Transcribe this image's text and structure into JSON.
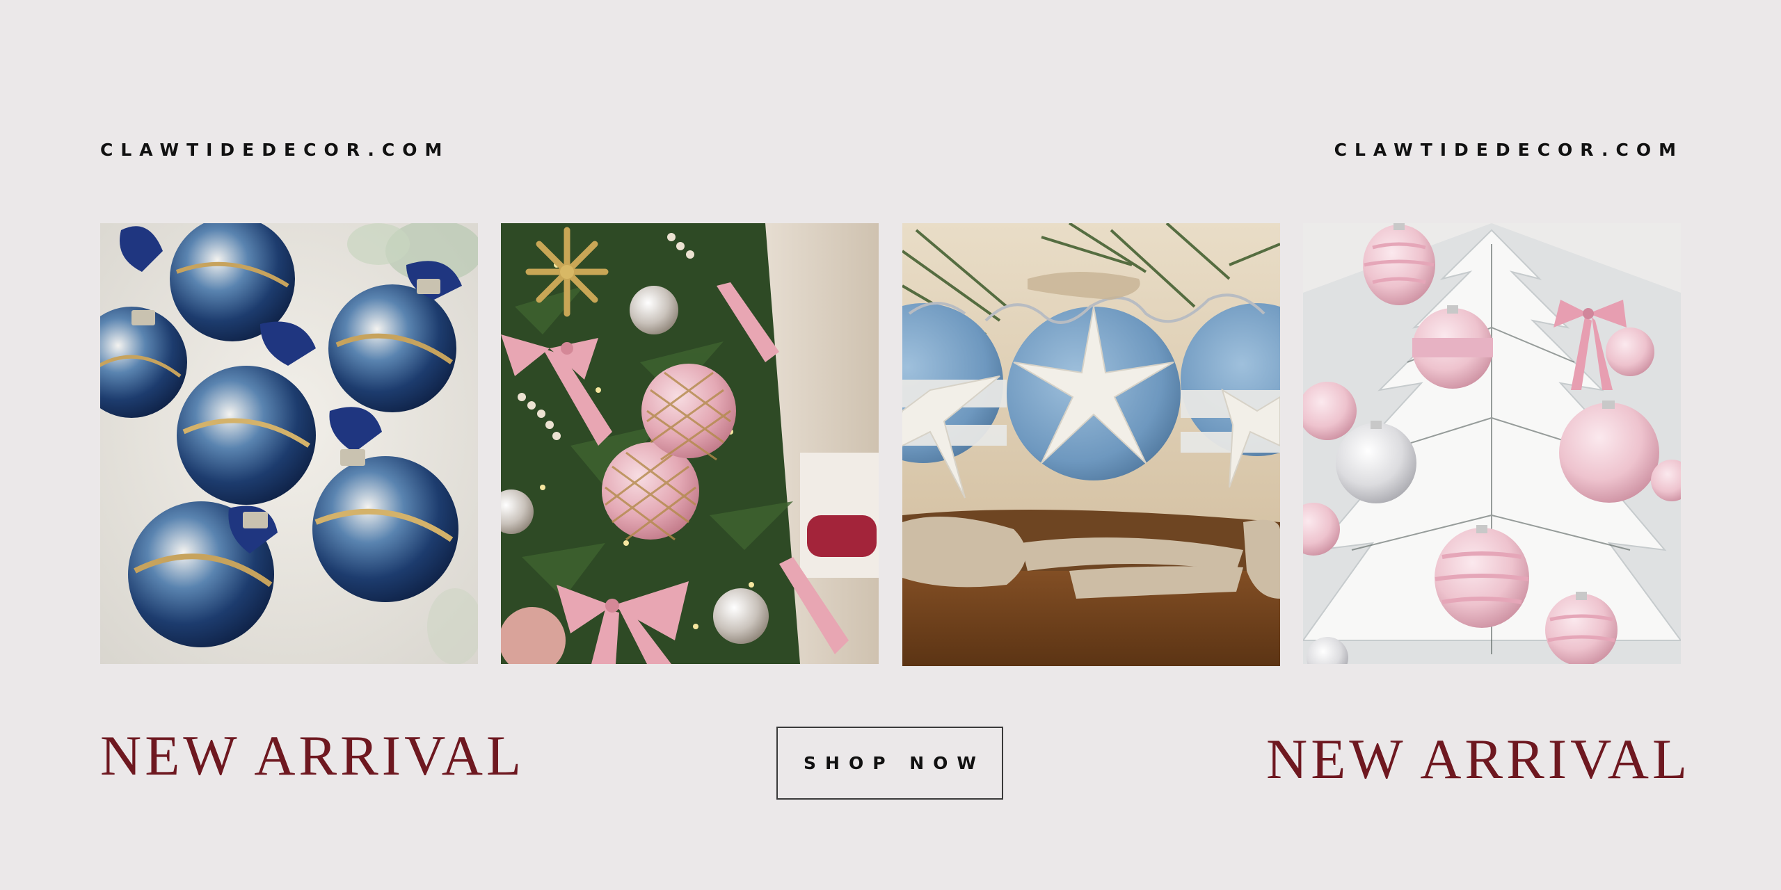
{
  "brand": {
    "domain_left": "CLAWTIDEDECOR.COM",
    "domain_right": "CLAWTIDEDECOR.COM"
  },
  "headlines": {
    "left": "NEW ARRIVAL",
    "right": "NEW ARRIVAL"
  },
  "cta": {
    "label": "SHOP NOW"
  },
  "photos": [
    {
      "subject": "navy-blue-and-gold-marbled-ornaments"
    },
    {
      "subject": "pink-bows-and-pink-ornaments-on-green-tree"
    },
    {
      "subject": "blue-yarn-starfish-ornaments-with-driftwood"
    },
    {
      "subject": "pink-and-silver-ornaments-on-flocked-tree"
    }
  ],
  "colors": {
    "background": "#ebe8e9",
    "headline": "#6e1820",
    "text": "#111111"
  }
}
